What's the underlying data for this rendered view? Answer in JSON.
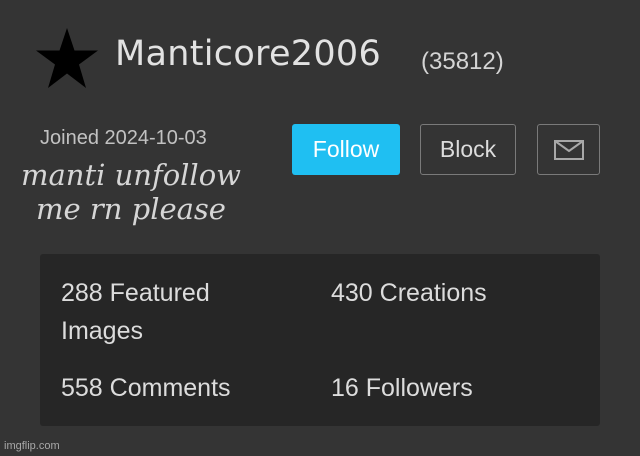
{
  "profile": {
    "star_icon": "star-icon",
    "username": "Manticore2006",
    "user_id": "(35812)",
    "joined": "Joined 2024-10-03",
    "caption": "manti unfollow me rn please"
  },
  "actions": {
    "follow_label": "Follow",
    "block_label": "Block",
    "message_icon": "envelope-icon"
  },
  "stats": {
    "featured_images": "288 Featured Images",
    "creations": "430 Creations",
    "comments": "558 Comments",
    "followers": "16 Followers"
  },
  "watermark": "imgflip.com",
  "colors": {
    "background": "#343434",
    "panel": "#262626",
    "follow_button": "#1fbff2",
    "text": "#dcdcdc"
  }
}
